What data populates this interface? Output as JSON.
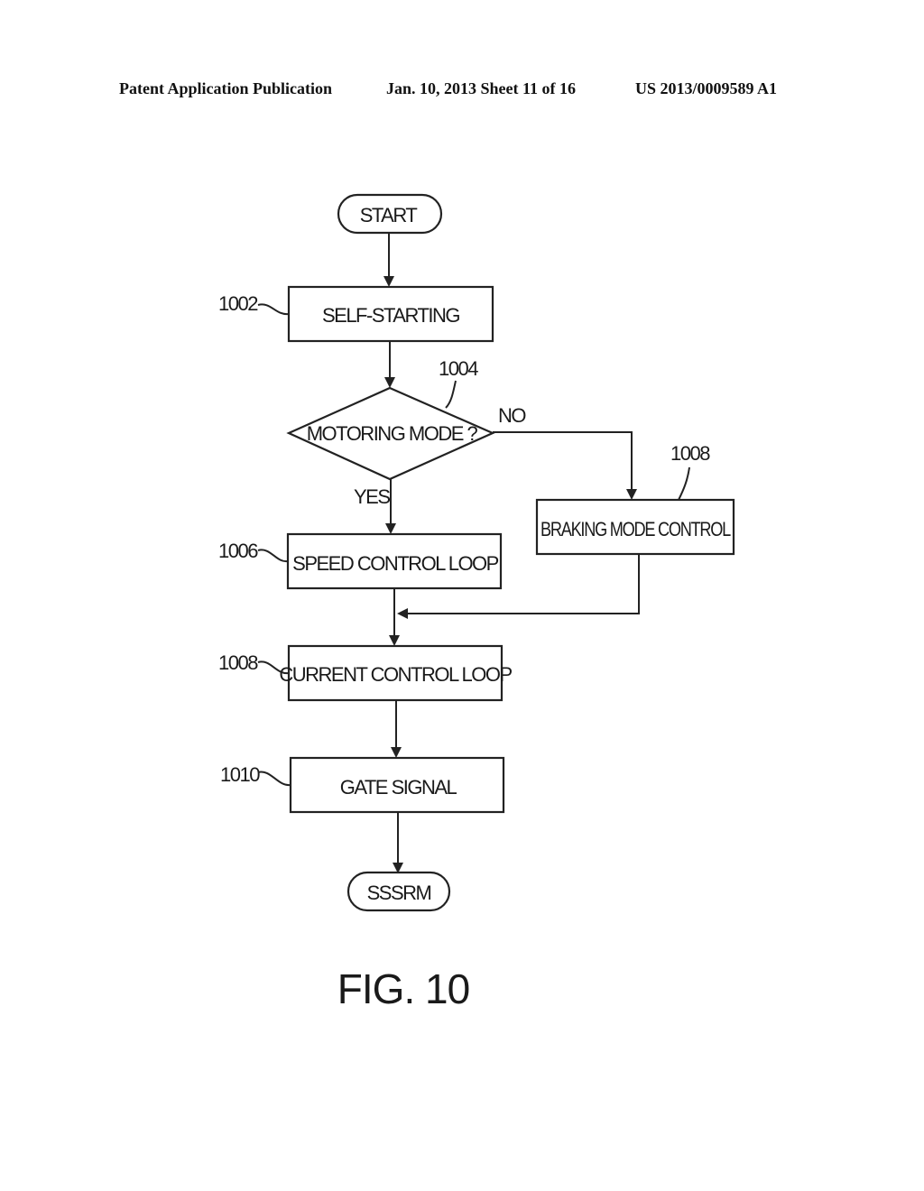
{
  "header": {
    "publication": "Patent Application Publication",
    "date_sheet": "Jan. 10, 2013  Sheet 11 of 16",
    "number": "US 2013/0009589 A1"
  },
  "flowchart": {
    "start": "START",
    "end": "SSSRM",
    "steps": {
      "self_starting": {
        "ref": "1002",
        "label": "SELF-STARTING"
      },
      "decision": {
        "ref": "1004",
        "label": "MOTORING MODE ?",
        "yes": "YES",
        "no": "NO"
      },
      "speed_loop": {
        "ref": "1006",
        "label": "SPEED CONTROL LOOP"
      },
      "braking": {
        "ref": "1008",
        "label": "BRAKING MODE CONTROL"
      },
      "current_loop": {
        "ref": "1008",
        "label": "CURRENT CONTROL LOOP"
      },
      "gate_signal": {
        "ref": "1010",
        "label": "GATE SIGNAL"
      }
    }
  },
  "figure_label": "FIG. 10"
}
